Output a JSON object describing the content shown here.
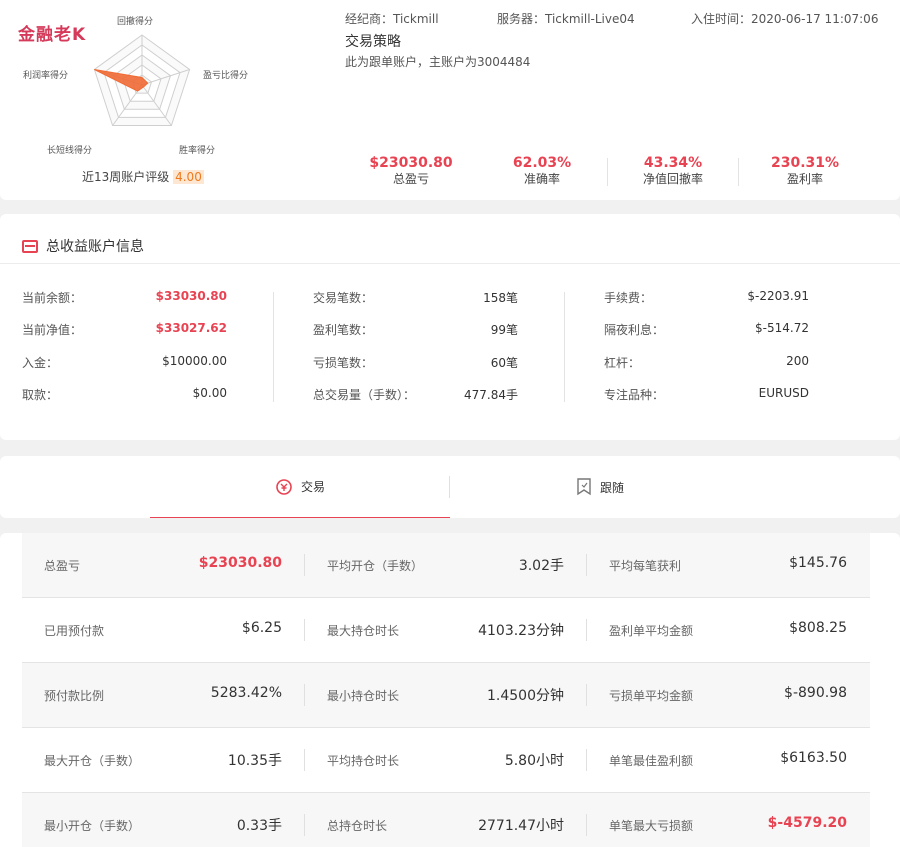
{
  "watermark": "金融老K",
  "radar": {
    "labels": [
      "回撤得分",
      "盈亏比得分",
      "胜率得分",
      "长短线得分",
      "利润率得分"
    ],
    "scores": [
      0.15,
      0.12,
      0.05,
      0.15,
      1.0
    ]
  },
  "rating": {
    "label": "近13周账户评级",
    "value": "4.00"
  },
  "header": {
    "broker": "经纪商：Tickmill",
    "server": "服务器：Tickmill-Live04",
    "join_time": "入住时间：2020-06-17 11:07:06",
    "strategy_title": "交易策略",
    "strategy_desc": "此为跟单账户，主账户为3004484"
  },
  "stats": [
    {
      "value": "$23030.80",
      "label": "总盈亏"
    },
    {
      "value": "62.03%",
      "label": "准确率"
    },
    {
      "value": "43.34%",
      "label": "净值回撤率"
    },
    {
      "value": "230.31%",
      "label": "盈利率"
    }
  ],
  "account": {
    "title": "总收益账户信息",
    "col1": [
      {
        "label": "当前余额：",
        "value": "$33030.80",
        "highlight": true
      },
      {
        "label": "当前净值：",
        "value": "$33027.62",
        "highlight": true
      },
      {
        "label": "入金：",
        "value": "$10000.00"
      },
      {
        "label": "取款：",
        "value": "$0.00"
      }
    ],
    "col2": [
      {
        "label": "交易笔数：",
        "value": "158笔"
      },
      {
        "label": "盈利笔数：",
        "value": "99笔"
      },
      {
        "label": "亏损笔数：",
        "value": "60笔"
      },
      {
        "label": "总交易量（手数）：",
        "value": "477.84手"
      }
    ],
    "col3": [
      {
        "label": "手续费：",
        "value": "$-2203.91"
      },
      {
        "label": "隔夜利息：",
        "value": "$-514.72"
      },
      {
        "label": "杠杆：",
        "value": "200"
      },
      {
        "label": "专注品种：",
        "value": "EURUSD"
      }
    ]
  },
  "tabs": {
    "trade": "交易",
    "follow": "跟随"
  },
  "grid": [
    [
      {
        "label": "总盈亏",
        "value": "$23030.80",
        "highlight": true
      },
      {
        "label": "平均开仓（手数）",
        "value": "3.02手"
      },
      {
        "label": "平均每笔获利",
        "value": "$145.76"
      }
    ],
    [
      {
        "label": "已用预付款",
        "value": "$6.25"
      },
      {
        "label": "最大持仓时长",
        "value": "4103.23分钟"
      },
      {
        "label": "盈利单平均金额",
        "value": "$808.25"
      }
    ],
    [
      {
        "label": "预付款比例",
        "value": "5283.42%"
      },
      {
        "label": "最小持仓时长",
        "value": "1.4500分钟"
      },
      {
        "label": "亏损单平均金额",
        "value": "$-890.98"
      }
    ],
    [
      {
        "label": "最大开仓（手数）",
        "value": "10.35手"
      },
      {
        "label": "平均持仓时长",
        "value": "5.80小时"
      },
      {
        "label": "单笔最佳盈利额",
        "value": "$6163.50"
      }
    ],
    [
      {
        "label": "最小开仓（手数）",
        "value": "0.33手"
      },
      {
        "label": "总持仓时长",
        "value": "2771.47小时"
      },
      {
        "label": "单笔最大亏损额",
        "value": "$-4579.20",
        "highlight": true
      }
    ]
  ]
}
